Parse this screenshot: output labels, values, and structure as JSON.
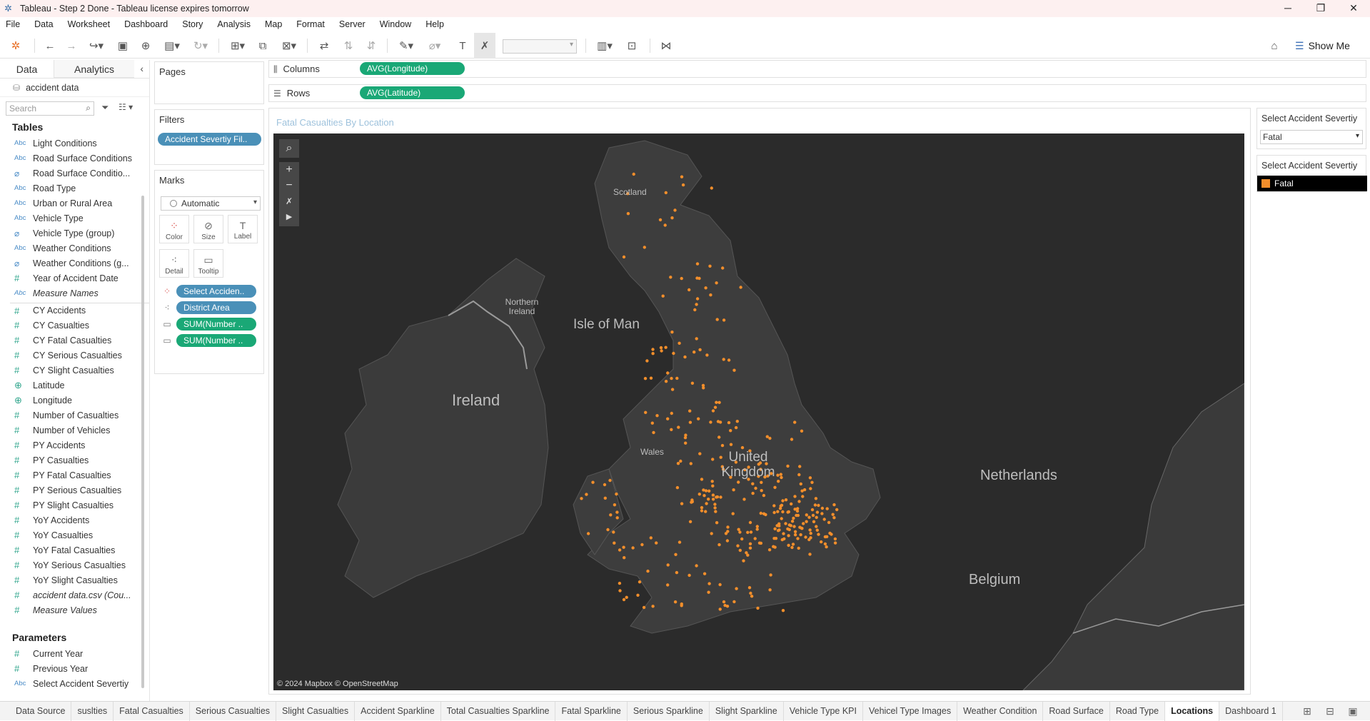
{
  "window": {
    "title": "Tableau - Step 2 Done - Tableau license expires tomorrow"
  },
  "menu": [
    "File",
    "Data",
    "Worksheet",
    "Dashboard",
    "Story",
    "Analysis",
    "Map",
    "Format",
    "Server",
    "Window",
    "Help"
  ],
  "toolbar": {
    "show_me": "Show Me"
  },
  "data_pane": {
    "tab_data": "Data",
    "tab_analytics": "Analytics",
    "datasource": "accident data",
    "search_placeholder": "Search",
    "tables_heading": "Tables",
    "fields": [
      {
        "type": "Abc",
        "name": "Light Conditions"
      },
      {
        "type": "Abc",
        "name": "Road Surface Conditions"
      },
      {
        "type": "grp",
        "name": "Road Surface Conditio..."
      },
      {
        "type": "Abc",
        "name": "Road Type"
      },
      {
        "type": "Abc",
        "name": "Urban or Rural Area"
      },
      {
        "type": "Abc",
        "name": "Vehicle Type"
      },
      {
        "type": "grp",
        "name": "Vehicle Type (group)"
      },
      {
        "type": "Abc",
        "name": "Weather Conditions"
      },
      {
        "type": "grp",
        "name": "Weather Conditions (g..."
      },
      {
        "type": "num",
        "name": "Year of Accident Date"
      },
      {
        "type": "Abc",
        "name": "Measure Names",
        "italic": true
      },
      {
        "type": "num",
        "name": "CY Accidents"
      },
      {
        "type": "num",
        "name": "CY Casualties"
      },
      {
        "type": "num",
        "name": "CY Fatal Casualties"
      },
      {
        "type": "num",
        "name": "CY Serious Casualties"
      },
      {
        "type": "num",
        "name": "CY Slight Casualties"
      },
      {
        "type": "geo",
        "name": "Latitude"
      },
      {
        "type": "geo",
        "name": "Longitude"
      },
      {
        "type": "num",
        "name": "Number of Casualties"
      },
      {
        "type": "num",
        "name": "Number of Vehicles"
      },
      {
        "type": "num",
        "name": "PY Accidents"
      },
      {
        "type": "num",
        "name": "PY Casualties"
      },
      {
        "type": "num",
        "name": "PY Fatal Casualties"
      },
      {
        "type": "num",
        "name": "PY Serious Casualties"
      },
      {
        "type": "num",
        "name": "PY Slight Casualties"
      },
      {
        "type": "num",
        "name": "YoY Accidents"
      },
      {
        "type": "num",
        "name": "YoY Casualties"
      },
      {
        "type": "num",
        "name": "YoY Fatal Casualties"
      },
      {
        "type": "num",
        "name": "YoY Serious Casualties"
      },
      {
        "type": "num",
        "name": "YoY Slight Casualties"
      },
      {
        "type": "num",
        "name": "accident data.csv (Cou...",
        "italic": true
      },
      {
        "type": "num",
        "name": "Measure Values",
        "italic": true
      }
    ],
    "parameters_heading": "Parameters",
    "parameters": [
      {
        "type": "num",
        "name": "Current Year"
      },
      {
        "type": "num",
        "name": "Previous Year"
      },
      {
        "type": "Abc",
        "name": "Select Accident Severtiy"
      }
    ]
  },
  "cards": {
    "pages": "Pages",
    "filters": "Filters",
    "filter_pill": "Accident Severtiy Fil..",
    "marks": "Marks",
    "mark_type": "Automatic",
    "mark_buttons": [
      "Color",
      "Size",
      "Label",
      "Detail",
      "Tooltip"
    ],
    "mark_pills": [
      "Select Acciden..",
      "District Area",
      "SUM(Number ..",
      "SUM(Number .."
    ]
  },
  "shelves": {
    "columns_label": "Columns",
    "columns_pill": "AVG(Longitude)",
    "rows_label": "Rows",
    "rows_pill": "AVG(Latitude)"
  },
  "viz": {
    "title": "Fatal Casualties By Location",
    "attribution": "© 2024 Mapbox © OpenStreetMap",
    "map_labels": {
      "scotland": "Scotland",
      "northern_ireland": "Northern Ireland",
      "isle_of_man": "Isle of Man",
      "ireland": "Ireland",
      "wales": "Wales",
      "united_kingdom": "United Kingdom",
      "netherlands": "Netherlands",
      "belgium": "Belgium"
    },
    "mark_color": "#f28e2b"
  },
  "legend": {
    "param_title": "Select Accident Severtiy",
    "param_value": "Fatal",
    "color_title": "Select Accident Severtiy",
    "color_item": "Fatal"
  },
  "sheet_tabs": [
    "Data Source",
    "suslties",
    "Fatal Casualties",
    "Serious Casualties",
    "Slight Casualties",
    "Accident Sparkline",
    "Total Casualties Sparkline",
    "Fatal Sparkline",
    "Serious Sparkline",
    "Slight Sparkline",
    "Vehicle Type KPI",
    "Vehicel Type Images",
    "Weather Condition",
    "Road Surface",
    "Road Type",
    "Locations",
    "Dashboard 1"
  ],
  "active_tab": "Locations"
}
